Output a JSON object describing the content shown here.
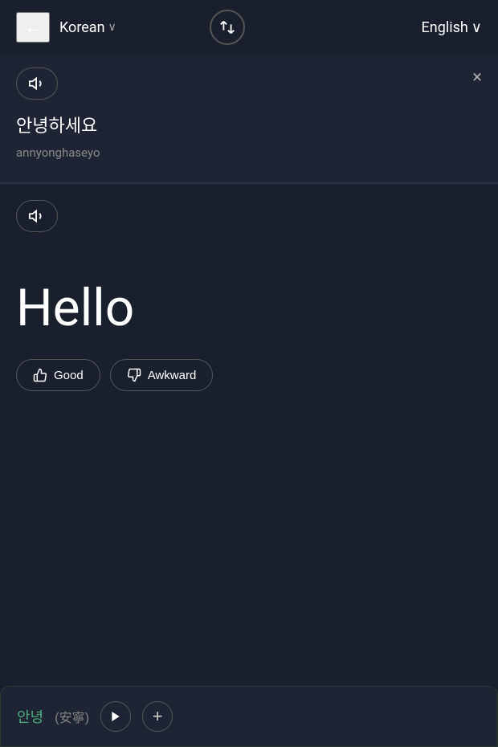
{
  "header": {
    "back_label": "←",
    "source_lang": "Korean",
    "source_lang_chevron": "∨",
    "swap_icon": "⇄",
    "target_lang": "English",
    "target_lang_chevron": "∨"
  },
  "source": {
    "speaker_title": "Play source audio",
    "close_label": "×",
    "korean_text": "안녕하세요",
    "romanization": "annyonghaseyo"
  },
  "translation": {
    "speaker_title": "Play translation audio",
    "translated_text": "Hello",
    "good_label": "Good",
    "awkward_label": "Awkward"
  },
  "bottom_bar": {
    "word": "안녕",
    "word_annotation": "(安寧)",
    "play_label": "▶",
    "add_label": "+"
  },
  "colors": {
    "background": "#1a1f2e",
    "surface": "#1e2433",
    "accent_green": "#4caf82",
    "border": "#2a3040",
    "muted": "#888888"
  }
}
